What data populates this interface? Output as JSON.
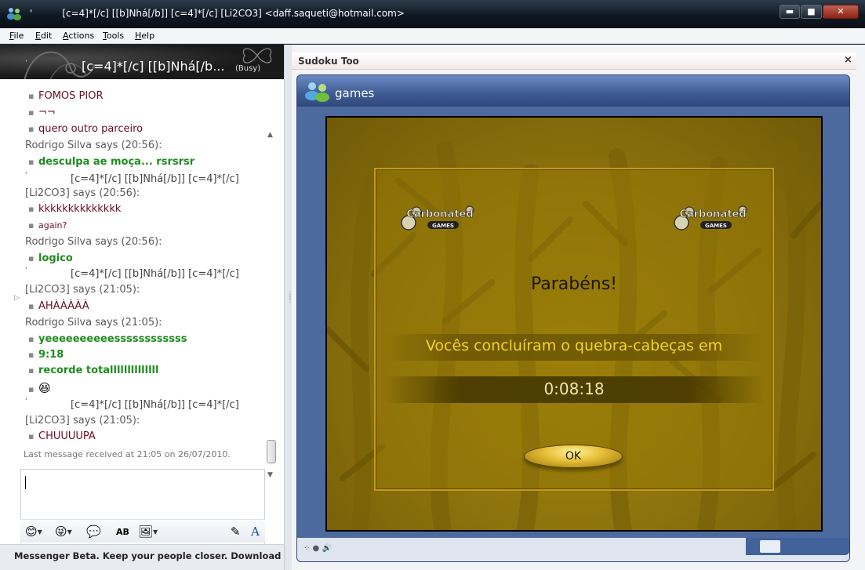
{
  "window": {
    "title_prefix": "'",
    "title_nick": "[c=4]*[/c] [[b]Nhá[/b]] [c=4]*[/c]  [Li2CO3] <daff.saqueti@hotmail.com>",
    "minimize_label": "▬",
    "maximize_label": "■",
    "close_label": "✕"
  },
  "menu": [
    "File",
    "Edit",
    "Actions",
    "Tools",
    "Help"
  ],
  "banner": {
    "prefix": "'",
    "name": "[c=4]*[/c] [[b]Nhá[/b...",
    "status": "(Busy)"
  },
  "chat": {
    "lines": [
      {
        "kind": "msg",
        "style": "maroon",
        "text": "FOMOS PIOR"
      },
      {
        "kind": "msg",
        "style": "maroon",
        "text": "¬¬"
      },
      {
        "kind": "msg",
        "style": "maroon",
        "text": "quero outro parceiro"
      },
      {
        "kind": "says",
        "text": "Rodrigo Silva says (20:56):"
      },
      {
        "kind": "msg",
        "style": "green",
        "text": "desculpa ae moça... rsrsrsr"
      },
      {
        "kind": "nick",
        "text": "[c=4]*[/c] [[b]Nhá[/b]] [c=4]*[/c]"
      },
      {
        "kind": "says",
        "text": "[Li2CO3] says (20:56):"
      },
      {
        "kind": "msg",
        "style": "maroon",
        "text": "kkkkkkkkkkkkkk"
      },
      {
        "kind": "msg",
        "style": "maroon small",
        "text": "again?"
      },
      {
        "kind": "says",
        "text": "Rodrigo Silva says (20:56):"
      },
      {
        "kind": "msg",
        "style": "green",
        "text": "logico"
      },
      {
        "kind": "nick",
        "text": "[c=4]*[/c] [[b]Nhá[/b]] [c=4]*[/c]"
      },
      {
        "kind": "says",
        "text": "[Li2CO3] says (21:05):"
      },
      {
        "kind": "msg",
        "style": "maroon",
        "text": "AHÀÀÀÀÀ"
      },
      {
        "kind": "says",
        "text": "Rodrigo Silva says (21:05):"
      },
      {
        "kind": "msg",
        "style": "green",
        "text": "yeeeeeeeeeessssssssssss"
      },
      {
        "kind": "msg",
        "style": "green",
        "text": "9:18"
      },
      {
        "kind": "msg",
        "style": "green",
        "text": "recorde totallllllllllllll"
      },
      {
        "kind": "emoji",
        "text": ""
      },
      {
        "kind": "nick",
        "text": "[c=4]*[/c] [[b]Nhá[/b]] [c=4]*[/c]"
      },
      {
        "kind": "says",
        "text": "[Li2CO3] says (21:05):"
      },
      {
        "kind": "msg",
        "style": "maroon",
        "text": "CHUUUUPA"
      }
    ],
    "nick_prefix": "'",
    "last_message": "Last message received at 21:05 on 26/07/2010."
  },
  "toolbar": {
    "icons": [
      "emoticon-icon",
      "wink-icon",
      "nudge-icon",
      "font-spell-icon",
      "backgrounds-icon",
      "handwriting-icon",
      "font-icon"
    ]
  },
  "ad": "Messenger Beta. Keep your people closer. Download now.",
  "sudoku": {
    "header": "Sudoku Too",
    "close": "×",
    "bar_title": "games",
    "dialog_title": "Parabéns!",
    "dialog_message": "Vocês concluíram o quebra-cabeças em",
    "dialog_time": "0:08:18",
    "ok_label": "OK",
    "logo_text_top": "Carbonated",
    "logo_text_bottom": "GAMES"
  },
  "colors": {
    "maroon": "#6b0f24",
    "green": "#1e8c1e",
    "gold_text": "#f5d41f"
  }
}
